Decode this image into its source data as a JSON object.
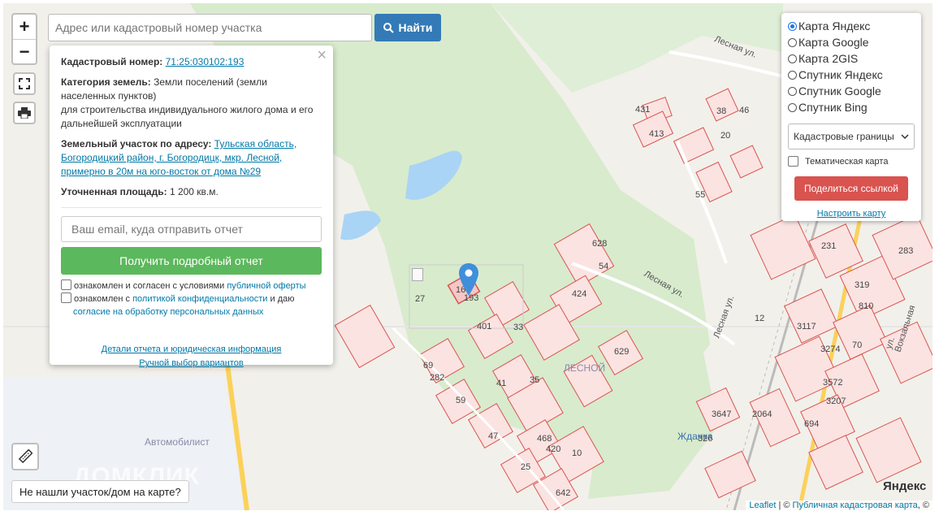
{
  "search": {
    "placeholder": "Адрес или кадастровый номер участка",
    "button_label": "Найти"
  },
  "zoom": {
    "in": "+",
    "out": "−"
  },
  "icons": {
    "fullscreen": "expand-icon",
    "print": "printer-icon",
    "ruler": "ruler-icon",
    "search": "search-icon",
    "pin": "map-pin-icon",
    "close": "close-icon"
  },
  "popup": {
    "cadastral_label": "Кадастровый номер:",
    "cadastral_number": "71:25:030102:193",
    "category_label": "Категория земель:",
    "category_value": "Земли поселений (земли населенных пунктов)",
    "category_purpose": "для строительства индивидуального жилого дома и его дальнейшей эксплуатации",
    "address_label": "Земельный участок по адресу:",
    "address_value": "Тульская область, Богородицкий район, г. Богородицк, мкр. Лесной, примерно в 20м на юго-восток от дома №29",
    "area_label": "Уточненная площадь:",
    "area_value": "1 200 кв.м.",
    "email_placeholder": "Ваш email, куда отправить отчет",
    "report_button": "Получить подробный отчет",
    "agree1_text": "ознакомлен и согласен с условиями",
    "agree1_link": "публичной оферты",
    "agree2_text": "ознакомлен с",
    "agree2_link": "политикой конфиденциальности",
    "agree2_mid": "и даю",
    "agree2_link2": "согласие на обработку персональных данных",
    "details_link": "Детали отчета и юридическая информация",
    "manual_link": "Ручной выбор вариантов",
    "close": "×"
  },
  "layers": {
    "options": [
      "Карта Яндекс",
      "Карта Google",
      "Карта 2GIS",
      "Спутник Яндекс",
      "Спутник Google",
      "Спутник Bing"
    ],
    "selected": "Карта Яндекс",
    "overlay_select": "Кадастровые границы",
    "thematic": "Тематическая карта",
    "share_button": "Поделиться ссылкой",
    "configure_link": "Настроить карту"
  },
  "not_found_button": "Не нашли участок/дом на карте?",
  "attribution": {
    "leaflet": "Leaflet",
    "separator": " | © ",
    "cadastral": "Публичная кадастровая карта",
    "copy": ", ©"
  },
  "map_labels": {
    "district": "ЛЕСНОЙ",
    "street1": "Лесная ул.",
    "street2": "Лесная ул.",
    "street3": "Лесная ул.",
    "street4": "ул. Вокзальная",
    "autopark": "Автомобилист",
    "station": "Жданка",
    "yandex": "Яндекс",
    "watermark": "ДОМКЛИК"
  },
  "parcel_numbers": [
    "193",
    "16",
    "27",
    "401",
    "33",
    "424",
    "629",
    "628",
    "431",
    "413",
    "55",
    "35",
    "69",
    "282",
    "59",
    "41",
    "47",
    "468",
    "420",
    "10",
    "25",
    "642",
    "38",
    "20",
    "46",
    "54",
    "12",
    "231",
    "283",
    "319",
    "810",
    "70",
    "3274",
    "3572",
    "3207",
    "694",
    "2064",
    "3647",
    "326",
    "3117"
  ],
  "colors": {
    "parcel_stroke": "#d9544f",
    "parcel_fill": "#f4c7c6",
    "water": "#aad4f5",
    "green": "#d8ebcd",
    "road": "#fbd15a",
    "pin": "#3f8fdb"
  }
}
